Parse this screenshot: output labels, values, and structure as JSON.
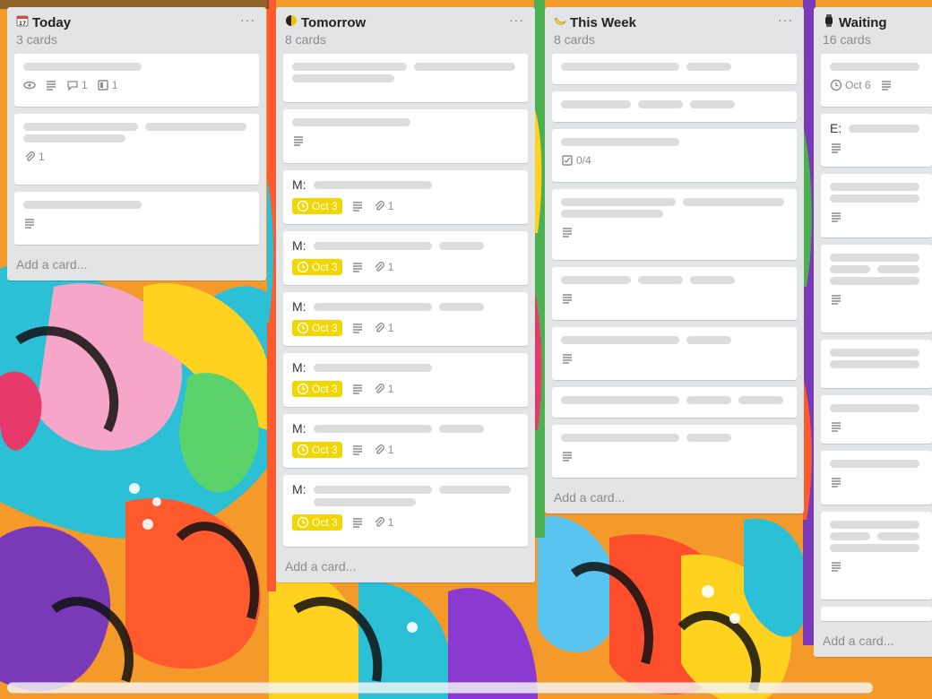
{
  "lists": [
    {
      "title": "Today",
      "icon": "calendar-icon",
      "count": "3 cards",
      "add": "Add a card..."
    },
    {
      "title": "Tomorrow",
      "icon": "moon-icon",
      "count": "8 cards",
      "add": "Add a card..."
    },
    {
      "title": "This Week",
      "icon": "banana-icon",
      "count": "8 cards",
      "add": "Add a card..."
    },
    {
      "title": "Waiting",
      "icon": "watch-icon",
      "count": "16 cards",
      "add": "Add a card..."
    }
  ],
  "menu_glyph": "···",
  "today_cards": {
    "c1": {
      "comments": "1",
      "checklist": "1"
    },
    "c2": {
      "attach": "1"
    }
  },
  "tomorrow_cards": {
    "prefix": "M:",
    "due": "Oct 3",
    "attach": "1"
  },
  "week_cards": {
    "checklist": "0/4"
  },
  "waiting_cards": {
    "due": "Oct 6",
    "prefix": "E:"
  },
  "colors": {
    "due_yellow": "#f2d600",
    "list_bg": "#e2e4e6"
  }
}
